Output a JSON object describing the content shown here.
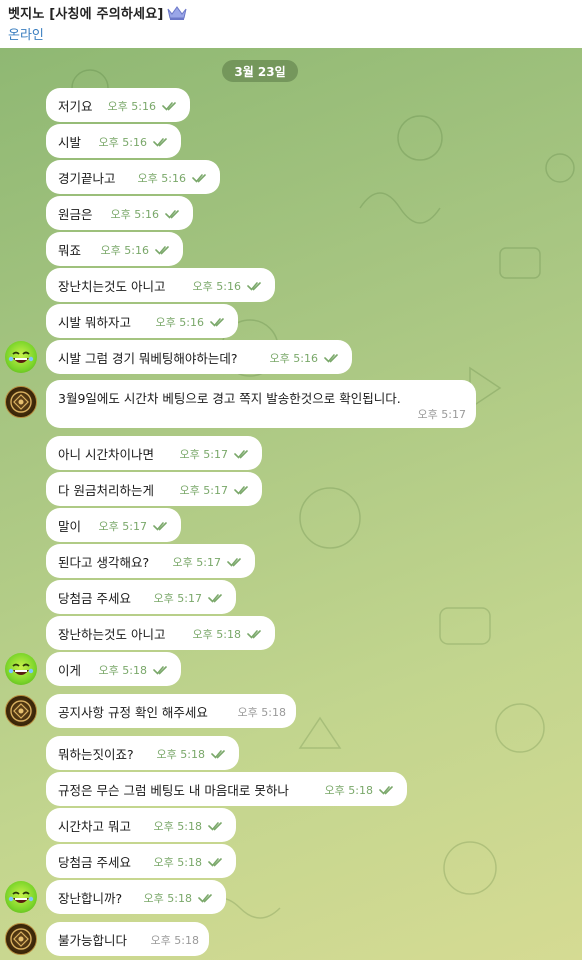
{
  "header": {
    "title": "벳지노 [사칭에 주의하세요]",
    "status": "온라인",
    "crown_icon": "crown-icon"
  },
  "date_label": "3월 23일",
  "messages": [
    {
      "text": "저기요",
      "time": "오후 5:16",
      "read": true
    },
    {
      "text": "시발",
      "time": "오후 5:16",
      "read": true
    },
    {
      "text": "경기끝나고",
      "time": "오후 5:16",
      "read": true
    },
    {
      "text": "원금은",
      "time": "오후 5:16",
      "read": true
    },
    {
      "text": "뭐죠",
      "time": "오후 5:16",
      "read": true
    },
    {
      "text": "장난치는것도 아니고",
      "time": "오후 5:16",
      "read": true
    },
    {
      "text": "시발 뭐하자고",
      "time": "오후 5:16",
      "read": true
    },
    {
      "text": "시발 그럼 경기 뭐베팅해야하는데?",
      "time": "오후 5:16",
      "read": true
    },
    {
      "text": "3월9일에도 시간차 베팅으로 경고 쪽지 발송한것으로 확인됩니다.",
      "time": "오후 5:17",
      "read": false
    },
    {
      "text": "아니 시간차이나면",
      "time": "오후 5:17",
      "read": true
    },
    {
      "text": "다 원금처리하는게",
      "time": "오후 5:17",
      "read": true
    },
    {
      "text": "말이",
      "time": "오후 5:17",
      "read": true
    },
    {
      "text": "된다고 생각해요?",
      "time": "오후 5:17",
      "read": true
    },
    {
      "text": "당첨금 주세요",
      "time": "오후 5:17",
      "read": true
    },
    {
      "text": "장난하는것도 아니고",
      "time": "오후 5:18",
      "read": true
    },
    {
      "text": "이게",
      "time": "오후 5:18",
      "read": true
    },
    {
      "text": "공지사항 규정 확인 해주세요",
      "time": "오후 5:18",
      "read": false
    },
    {
      "text": "뭐하는짓이죠?",
      "time": "오후 5:18",
      "read": true
    },
    {
      "text": "규정은 무슨 그럼 베팅도 내 마음대로 못하나",
      "time": "오후 5:18",
      "read": true
    },
    {
      "text": "시간차고 뭐고",
      "time": "오후 5:18",
      "read": true
    },
    {
      "text": "당첨금 주세요",
      "time": "오후 5:18",
      "read": true
    },
    {
      "text": "장난합니까?",
      "time": "오후 5:18",
      "read": true
    },
    {
      "text": "불가능합니다",
      "time": "오후 5:18",
      "read": false
    }
  ],
  "colors": {
    "bubble": "#ffffff",
    "time_outgoing": "#7aa86a",
    "time_incoming": "#9a9a9a",
    "status": "#3a7ebf"
  }
}
